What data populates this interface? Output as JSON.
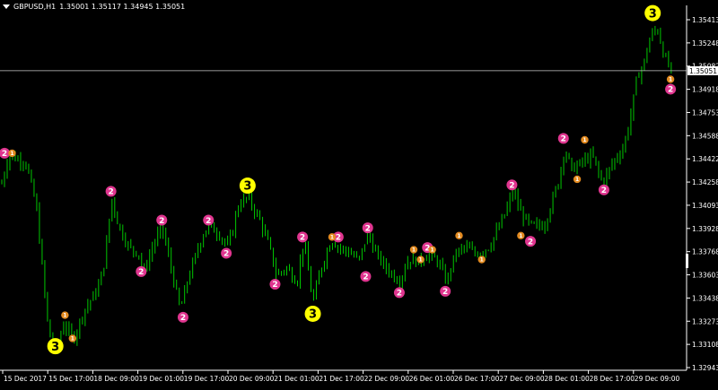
{
  "header": {
    "symbol": "GBPUSD,H1",
    "ohlc": "1.35001 1.35117 1.34945 1.35051",
    "collapse_icon": "triangle-down-icon"
  },
  "colors": {
    "background": "#000000",
    "candles": "#00c800",
    "axis": "#ffffff",
    "bid_line": "#c8c8c8",
    "wave3": "#ffff00",
    "wave2": "#e0358f",
    "wave1": "#e38a1f"
  },
  "price_axis": {
    "labels": [
      "1.35413",
      "1.35248",
      "1.35082",
      "1.34918",
      "1.34753",
      "1.34588",
      "1.34422",
      "1.34258",
      "1.34093",
      "1.33928",
      "1.33768",
      "1.33603",
      "1.33438",
      "1.33273",
      "1.33108",
      "1.32943"
    ],
    "current": "1.35051",
    "min": 1.32943,
    "max": 1.35413
  },
  "time_axis": {
    "labels": [
      "15 Dec 2017",
      "15 Dec 17:00",
      "18 Dec 09:00",
      "19 Dec 01:00",
      "19 Dec 17:00",
      "20 Dec 09:00",
      "21 Dec 01:00",
      "21 Dec 17:00",
      "22 Dec 09:00",
      "26 Dec 01:00",
      "26 Dec 17:00",
      "27 Dec 09:00",
      "28 Dec 01:00",
      "28 Dec 17:00",
      "29 Dec 09:00"
    ]
  },
  "markers": [
    {
      "label": "3",
      "kind": "3",
      "price": 1.3546,
      "bar": 0.948
    },
    {
      "label": "3",
      "kind": "3",
      "price": 1.34235,
      "bar": 0.358
    },
    {
      "label": "3",
      "kind": "3",
      "price": 1.33325,
      "bar": 0.453
    },
    {
      "label": "3",
      "kind": "3",
      "price": 1.33095,
      "bar": 0.078
    },
    {
      "label": "2",
      "kind": "2",
      "price": 1.34465,
      "bar": 0.004
    },
    {
      "label": "2",
      "kind": "2",
      "price": 1.34195,
      "bar": 0.159
    },
    {
      "label": "2",
      "kind": "2",
      "price": 1.3399,
      "bar": 0.233
    },
    {
      "label": "2",
      "kind": "2",
      "price": 1.3399,
      "bar": 0.301
    },
    {
      "label": "2",
      "kind": "2",
      "price": 1.33625,
      "bar": 0.203
    },
    {
      "label": "2",
      "kind": "2",
      "price": 1.33755,
      "bar": 0.327
    },
    {
      "label": "2",
      "kind": "2",
      "price": 1.333,
      "bar": 0.264
    },
    {
      "label": "2",
      "kind": "2",
      "price": 1.33535,
      "bar": 0.398
    },
    {
      "label": "2",
      "kind": "2",
      "price": 1.3387,
      "bar": 0.438
    },
    {
      "label": "2",
      "kind": "2",
      "price": 1.3387,
      "bar": 0.49
    },
    {
      "label": "2",
      "kind": "2",
      "price": 1.33935,
      "bar": 0.533
    },
    {
      "label": "2",
      "kind": "2",
      "price": 1.3359,
      "bar": 0.53
    },
    {
      "label": "2",
      "kind": "2",
      "price": 1.33475,
      "bar": 0.579
    },
    {
      "label": "2",
      "kind": "2",
      "price": 1.33795,
      "bar": 0.62
    },
    {
      "label": "2",
      "kind": "2",
      "price": 1.33485,
      "bar": 0.646
    },
    {
      "label": "2",
      "kind": "2",
      "price": 1.3424,
      "bar": 0.743
    },
    {
      "label": "2",
      "kind": "2",
      "price": 1.3384,
      "bar": 0.77
    },
    {
      "label": "2",
      "kind": "2",
      "price": 1.3457,
      "bar": 0.818
    },
    {
      "label": "2",
      "kind": "2",
      "price": 1.34205,
      "bar": 0.877
    },
    {
      "label": "2",
      "kind": "2",
      "price": 1.3492,
      "bar": 0.974
    },
    {
      "label": "1",
      "kind": "1",
      "price": 1.34465,
      "bar": 0.015
    },
    {
      "label": "1",
      "kind": "1",
      "price": 1.33315,
      "bar": 0.092
    },
    {
      "label": "1",
      "kind": "1",
      "price": 1.3315,
      "bar": 0.103
    },
    {
      "label": "1",
      "kind": "1",
      "price": 1.3387,
      "bar": 0.481
    },
    {
      "label": "1",
      "kind": "1",
      "price": 1.3378,
      "bar": 0.6
    },
    {
      "label": "1",
      "kind": "1",
      "price": 1.3371,
      "bar": 0.61
    },
    {
      "label": "1",
      "kind": "1",
      "price": 1.3378,
      "bar": 0.627
    },
    {
      "label": "1",
      "kind": "1",
      "price": 1.3388,
      "bar": 0.666
    },
    {
      "label": "1",
      "kind": "1",
      "price": 1.3371,
      "bar": 0.699
    },
    {
      "label": "1",
      "kind": "1",
      "price": 1.3388,
      "bar": 0.756
    },
    {
      "label": "1",
      "kind": "1",
      "price": 1.3456,
      "bar": 0.849
    },
    {
      "label": "1",
      "kind": "1",
      "price": 1.3428,
      "bar": 0.838
    },
    {
      "label": "1",
      "kind": "1",
      "price": 1.3499,
      "bar": 0.974
    }
  ]
}
